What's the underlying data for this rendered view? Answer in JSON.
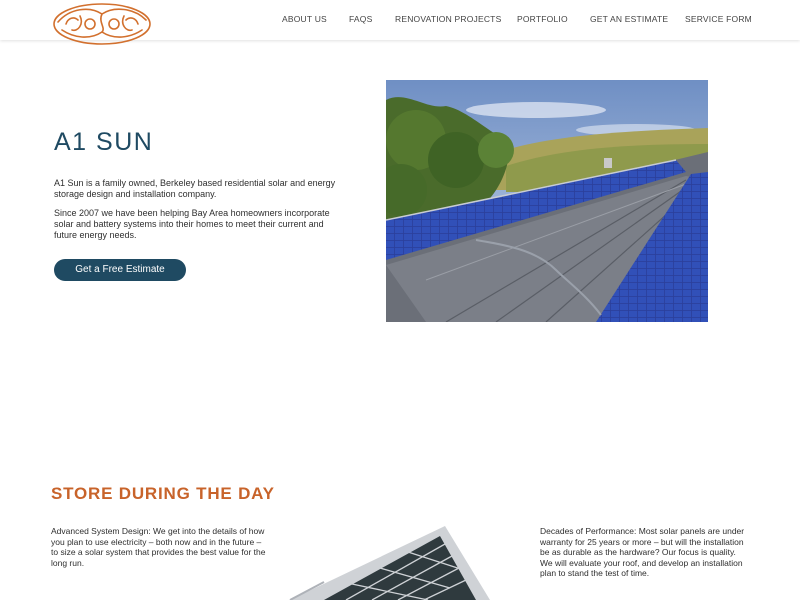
{
  "nav": {
    "items": [
      "ABOUT US",
      "FAQS",
      "RENOVATION PROJECTS",
      "PORTFOLIO",
      "GET AN ESTIMATE",
      "SERVICE FORM"
    ]
  },
  "hero": {
    "title": "A1 SUN",
    "paragraph1": "A1 Sun is a family owned, Berkeley based residential solar and energy storage design and installation company.",
    "paragraph2": "Since 2007 we have been helping Bay Area homeowners incorporate solar and battery systems into their homes to meet their current and future energy needs.",
    "cta_label": "Get a Free Estimate"
  },
  "section": {
    "title": "STORE DURING THE DAY",
    "left_text": "Advanced System Design:  We get into the details of how you plan to use electricity – both now and in the future – to size a solar system that provides the best value for the long run.",
    "right_text": "Decades of Performance:  Most solar panels are under warranty for 25 years or more – but will the installation be as durable as the hardware?  Our focus is quality.  We will evaluate your roof, and develop an installation plan to stand the test of time."
  },
  "colors": {
    "brand_navy": "#1f4a62",
    "accent_orange": "#c8632a"
  },
  "icons": {
    "logo": "a1-sun-logo-icon"
  }
}
